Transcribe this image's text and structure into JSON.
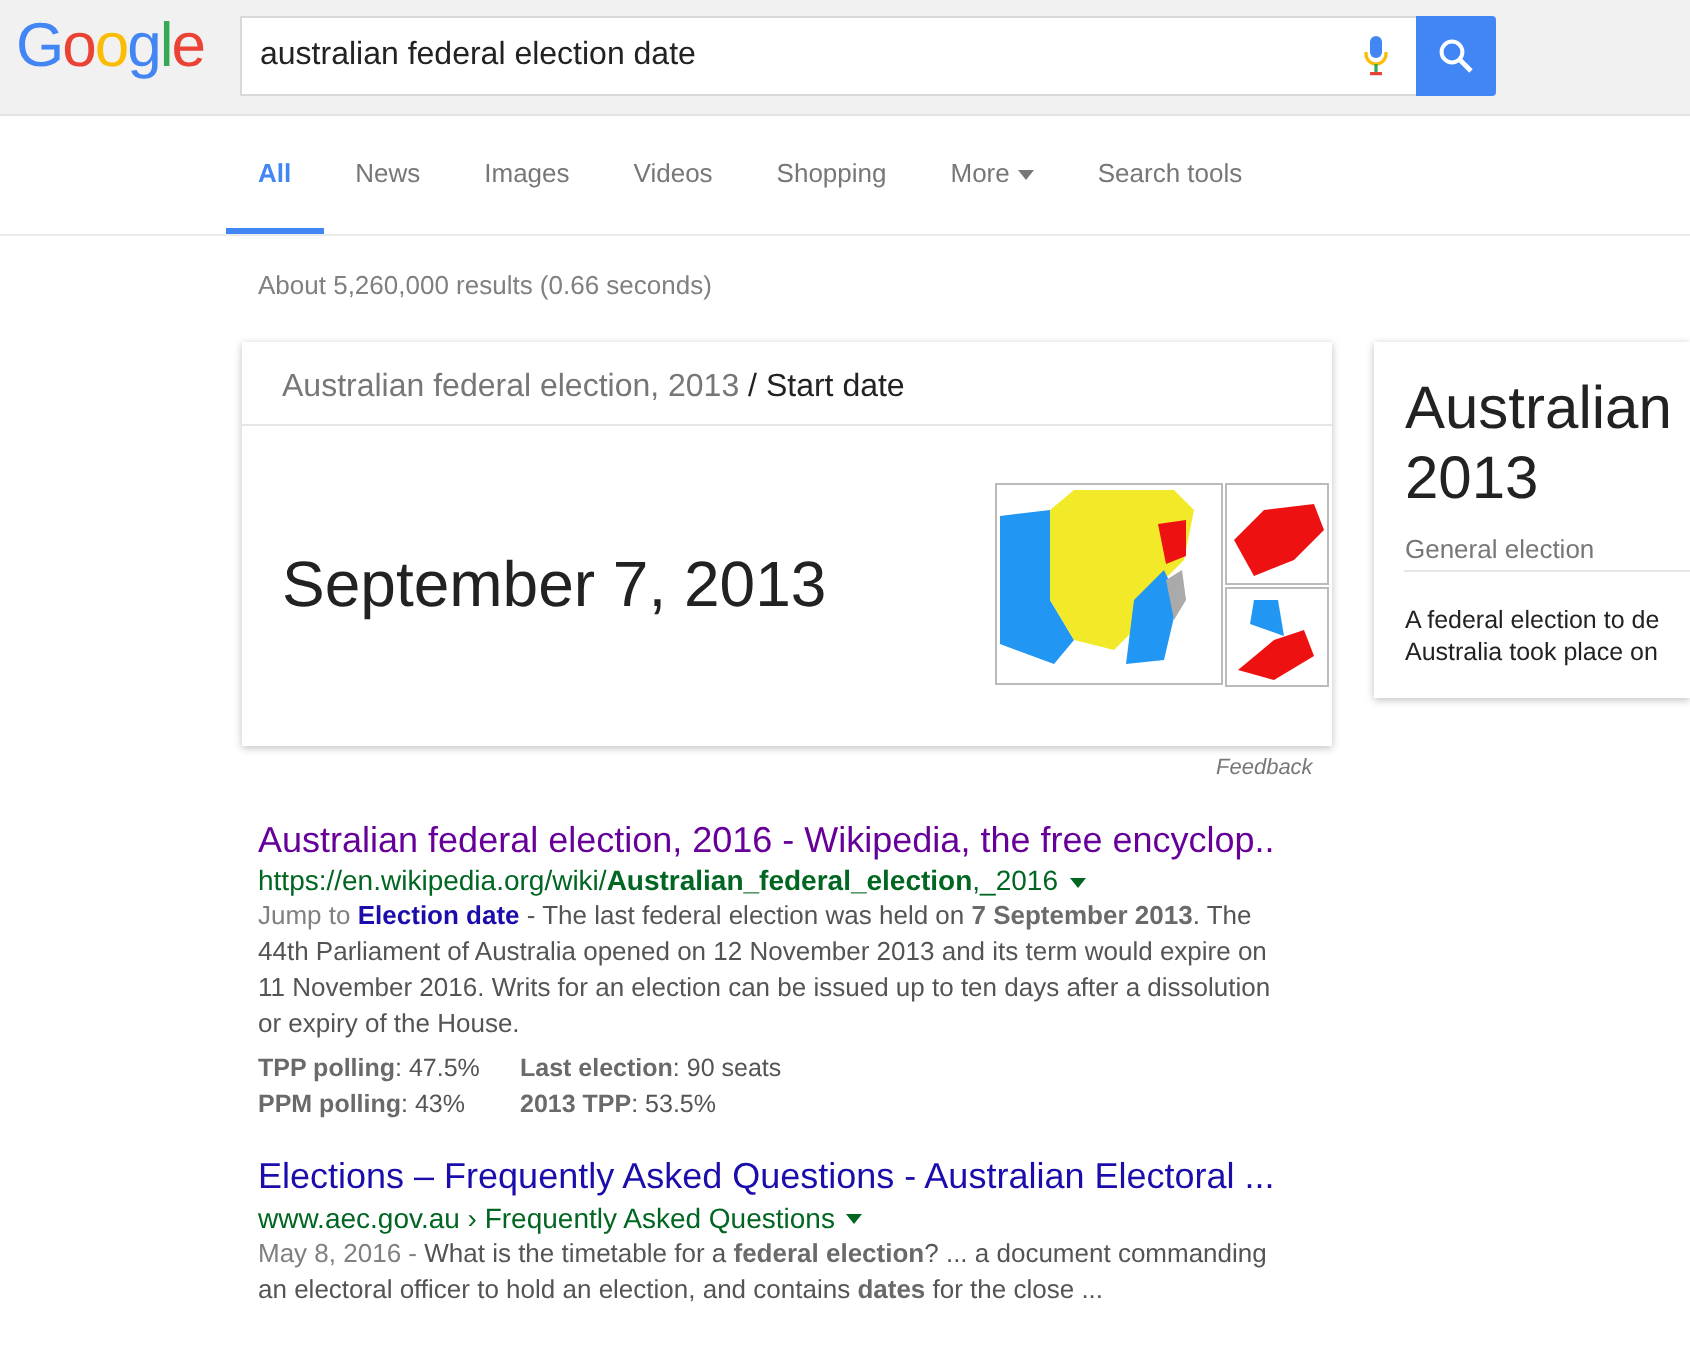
{
  "header": {
    "logo": "Google",
    "query": "australian federal election date"
  },
  "tabs": [
    {
      "label": "All",
      "selected": true,
      "kind": "tab"
    },
    {
      "label": "News",
      "selected": false,
      "kind": "tab"
    },
    {
      "label": "Images",
      "selected": false,
      "kind": "tab"
    },
    {
      "label": "Videos",
      "selected": false,
      "kind": "tab"
    },
    {
      "label": "Shopping",
      "selected": false,
      "kind": "tab"
    },
    {
      "label": "More",
      "selected": false,
      "kind": "menu"
    },
    {
      "label": "Search tools",
      "selected": false,
      "kind": "tab"
    }
  ],
  "result_stats": "About 5,260,000 results (0.66 seconds)",
  "answer_card": {
    "topic": "Australian federal election, 2013",
    "separator": "/",
    "attribute": "Start date",
    "answer": "September 7, 2013",
    "feedback": "Feedback"
  },
  "knowledge_panel": {
    "title_lines": [
      "Australian",
      "2013"
    ],
    "subtitle": "General election",
    "description_lines": [
      "A federal election to de",
      "Australia took place on"
    ]
  },
  "results": [
    {
      "title": "Australian federal election, 2016 - Wikipedia, the free encyclop..",
      "visited": true,
      "url": "https://en.wikipedia.org/wiki/**Australian_federal_election**,_2016",
      "prefix": "Jump to",
      "jump_link": "Election date",
      "snippet": " - The last federal election was held on **7 September 2013**. The 44th Parliament of Australia opened on 12 November 2013 and its term would expire on 11 November 2016. Writs for an election can be issued up to ten days after a dissolution or expiry of the House.",
      "facts": [
        [
          "**TPP polling**: 47.5%",
          "**PPM polling**: 43%"
        ],
        [
          "**Last election**: 90 seats",
          "**2013 TPP**: 53.5%"
        ]
      ]
    },
    {
      "title": "Elections – Frequently Asked Questions - Australian Electoral ...",
      "visited": false,
      "url": "www.aec.gov.au › Frequently Asked Questions",
      "prefix": "May 8, 2016 -",
      "snippet": " What is the timetable for a **federal election**? ... a document commanding an electoral officer to hold an election, and contains **dates** for the close ..."
    }
  ]
}
